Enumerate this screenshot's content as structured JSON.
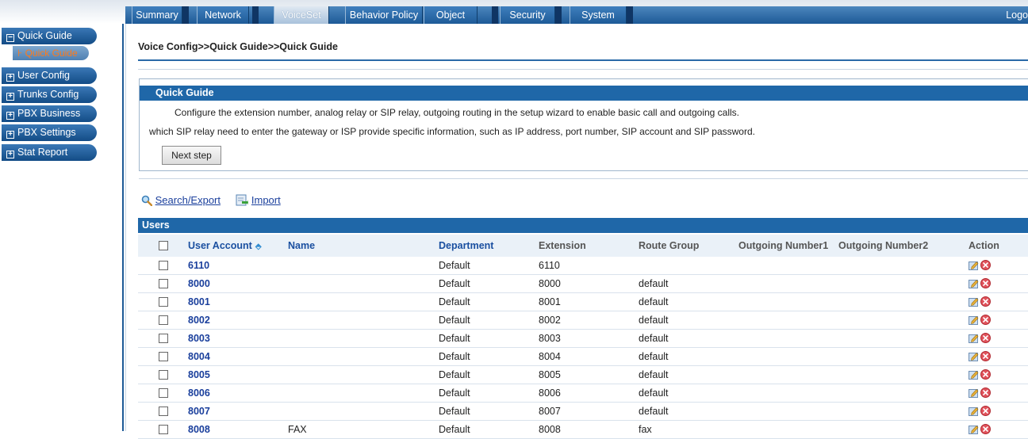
{
  "top_nav": {
    "tabs": [
      {
        "label": "Summary"
      },
      {
        "label": "Network"
      },
      {
        "label": "VoiceSet"
      },
      {
        "label": "Behavior Policy"
      },
      {
        "label": "Object"
      },
      {
        "label": "Security"
      },
      {
        "label": "System"
      }
    ],
    "active_tab": "VoiceSet",
    "logout_label": "Logo"
  },
  "sidebar": {
    "items": [
      {
        "label": "Quick Guide",
        "expanded": true
      },
      {
        "label": "User Config"
      },
      {
        "label": "Trunks Config"
      },
      {
        "label": "PBX Business"
      },
      {
        "label": "PBX Settings"
      },
      {
        "label": "Stat Report"
      }
    ],
    "sub_item": {
      "label": "Quick Guide"
    }
  },
  "breadcrumb": "Voice Config>>Quick Guide>>Quick Guide",
  "quick_guide": {
    "title": "Quick Guide",
    "line1": "Configure the extension number, analog relay or SIP relay, outgoing routing in the setup wizard to enable basic call and outgoing calls.",
    "line2": "which SIP relay need to enter the gateway or ISP provide specific information, such as IP address, port number, SIP account and SIP password.",
    "next_button": "Next step"
  },
  "toolbar": {
    "search_export": "Search/Export",
    "import": "Import"
  },
  "users": {
    "title": "Users",
    "columns": {
      "account": "User Account",
      "name": "Name",
      "department": "Department",
      "extension": "Extension",
      "route_group": "Route Group",
      "outgoing1": "Outgoing Number1",
      "outgoing2": "Outgoing Number2",
      "action": "Action"
    },
    "rows": [
      {
        "account": "6110",
        "name": "",
        "department": "Default",
        "extension": "6110",
        "route_group": "",
        "outgoing1": "",
        "outgoing2": ""
      },
      {
        "account": "8000",
        "name": "",
        "department": "Default",
        "extension": "8000",
        "route_group": "default",
        "outgoing1": "",
        "outgoing2": ""
      },
      {
        "account": "8001",
        "name": "",
        "department": "Default",
        "extension": "8001",
        "route_group": "default",
        "outgoing1": "",
        "outgoing2": ""
      },
      {
        "account": "8002",
        "name": "",
        "department": "Default",
        "extension": "8002",
        "route_group": "default",
        "outgoing1": "",
        "outgoing2": ""
      },
      {
        "account": "8003",
        "name": "",
        "department": "Default",
        "extension": "8003",
        "route_group": "default",
        "outgoing1": "",
        "outgoing2": ""
      },
      {
        "account": "8004",
        "name": "",
        "department": "Default",
        "extension": "8004",
        "route_group": "default",
        "outgoing1": "",
        "outgoing2": ""
      },
      {
        "account": "8005",
        "name": "",
        "department": "Default",
        "extension": "8005",
        "route_group": "default",
        "outgoing1": "",
        "outgoing2": ""
      },
      {
        "account": "8006",
        "name": "",
        "department": "Default",
        "extension": "8006",
        "route_group": "default",
        "outgoing1": "",
        "outgoing2": ""
      },
      {
        "account": "8007",
        "name": "",
        "department": "Default",
        "extension": "8007",
        "route_group": "default",
        "outgoing1": "",
        "outgoing2": ""
      },
      {
        "account": "8008",
        "name": "FAX",
        "department": "Default",
        "extension": "8008",
        "route_group": "fax",
        "outgoing1": "",
        "outgoing2": ""
      }
    ]
  },
  "icons": {
    "search": "magnifier-icon",
    "import": "import-icon",
    "edit": "edit-icon",
    "delete": "delete-icon",
    "sort": "sort-up-arrow-icon"
  },
  "colors": {
    "header_blue": "#1f67a8",
    "link_blue": "#1a3f9c",
    "active_sub_orange": "#ff7a1a"
  }
}
